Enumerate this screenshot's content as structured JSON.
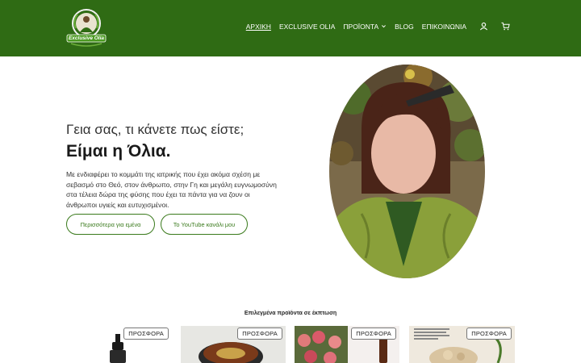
{
  "header": {
    "logo_text": "Exclusive Olia",
    "nav": [
      {
        "label": "ΑΡΧΙΚΗ",
        "active": true
      },
      {
        "label": "EXCLUSIVE OLIA",
        "active": false
      },
      {
        "label": "ΠΡΟΪΟΝΤΑ",
        "active": false,
        "has_dropdown": true
      },
      {
        "label": "BLOG",
        "active": false
      },
      {
        "label": "ΕΠΙΚΟΙΝΩΝΙΑ",
        "active": false
      }
    ],
    "icons": [
      "user-icon",
      "cart-icon"
    ]
  },
  "hero": {
    "greeting": "Γεια σας, τι κάνετε πως είστε;",
    "name": "Είμαι η Όλια.",
    "intro": "Με ενδιαφέρει το κομμάτι της ιατρικής που έχει ακόμα σχέση με σεβασμό στο Θεό, στον άνθρωπο, στην Γη και μεγάλη ευγνωμοσύνη στα τέλεια δώρα της φύσης που έχει τα πάντα για να ζουν οι άνθρωποι υγιείς και ευτυχισμένοι.",
    "button_more": "Περισσότερα για εμένα",
    "button_youtube": "Το YouTube κανάλι μου"
  },
  "featured": {
    "title": "Επιλεγμένα προϊόντα σε έκπτωση",
    "products": [
      {
        "badge": "ΠΡΟΣΦΟΡΑ"
      },
      {
        "badge": "ΠΡΟΣΦΟΡΑ"
      },
      {
        "badge": "ΠΡΟΣΦΟΡΑ"
      },
      {
        "badge": "ΠΡΟΣΦΟΡΑ"
      }
    ]
  },
  "colors": {
    "header_bg": "#2f6b14",
    "accent": "#3a7a1c"
  }
}
